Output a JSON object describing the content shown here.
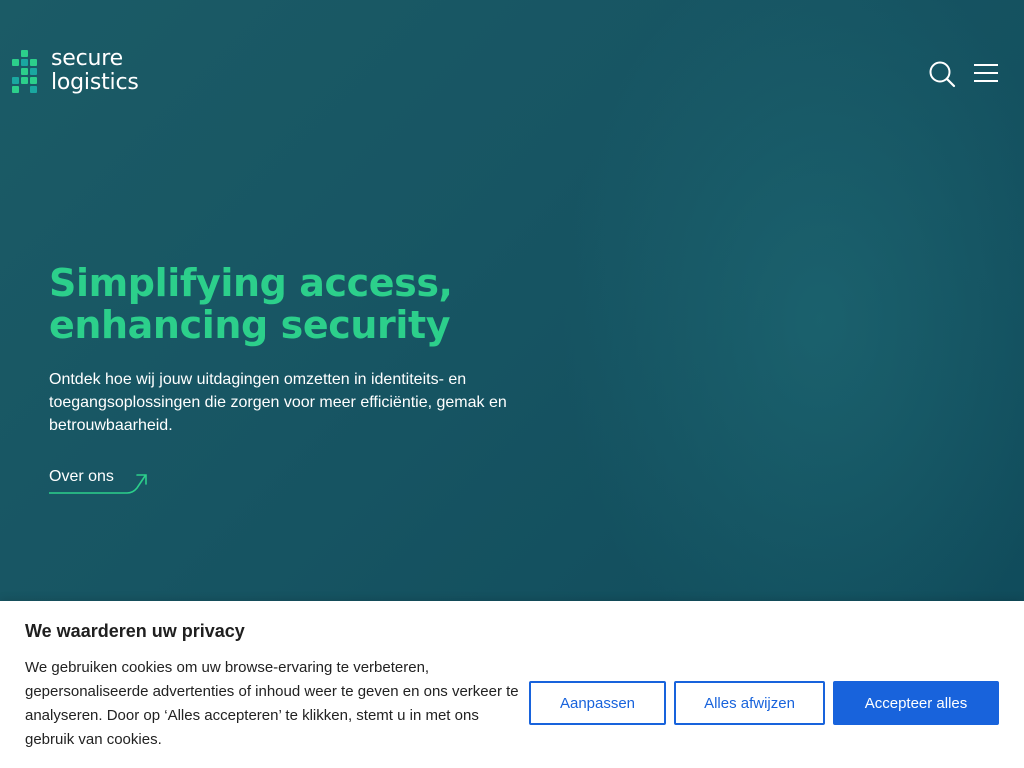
{
  "brand": {
    "logo_line1": "secure",
    "logo_line2": "logistics",
    "accent_color": "#2ccf8b",
    "mark_colors": [
      "#2ccf8b",
      "#1aa7a0"
    ]
  },
  "header": {
    "search_icon": "search-icon",
    "menu_icon": "hamburger-menu-icon"
  },
  "hero": {
    "headline_line1": "Simplifying access,",
    "headline_line2": "enhancing security",
    "lead": "Ontdek hoe wij jouw uitdagingen omzetten in identiteits- en toegangsoplossingen die zorgen voor meer efficiëntie, gemak en betrouwbaarheid.",
    "cta_label": "Over ons",
    "cta_icon": "arrow-up-right-icon",
    "background_color": "#175563"
  },
  "cookie_banner": {
    "title": "We waarderen uw privacy",
    "text": "We gebruiken cookies om uw browse-ervaring te verbeteren, gepersonaliseerde advertenties of inhoud weer te geven en ons verkeer te analyseren. Door op ‘Alles accepteren’ te klikken, stemt u in met ons gebruik van cookies.",
    "customize_label": "Aanpassen",
    "reject_label": "Alles afwijzen",
    "accept_label": "Accepteer alles",
    "button_color": "#1863dc"
  }
}
